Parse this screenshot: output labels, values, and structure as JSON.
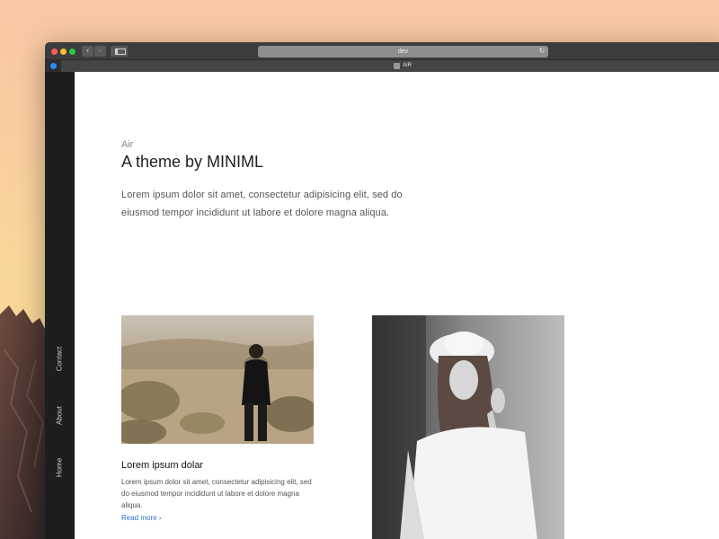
{
  "browser": {
    "url": "dev",
    "tab_title": "AIR",
    "back_glyph": "‹",
    "forward_glyph": "›",
    "reload_glyph": "↻"
  },
  "nav": {
    "items": [
      "Contact",
      "About",
      "Home"
    ]
  },
  "hero": {
    "eyebrow": "Air",
    "title": "A theme by MINIML",
    "text": "Lorem ipsum dolor sit amet, consectetur adipisicing elit, sed do eiusmod tempor incididunt ut labore et dolore magna aliqua."
  },
  "card": {
    "title": "Lorem ipsum dolar",
    "text": "Lorem ipsum dolor sit amet, consectetur adipisicing elit, sed do eiusmod tempor incididunt ut labore et dolore magna aliqua.",
    "link": "Read more ›"
  },
  "icons": {
    "back": "chevron-left-icon",
    "forward": "chevron-right-icon",
    "sidebar": "sidebar-icon",
    "reload": "reload-icon"
  },
  "colors": {
    "accent_link": "#2b6fcf",
    "nav_bg": "#1c1d1f",
    "titlebar_bg": "#3c3c3e"
  }
}
